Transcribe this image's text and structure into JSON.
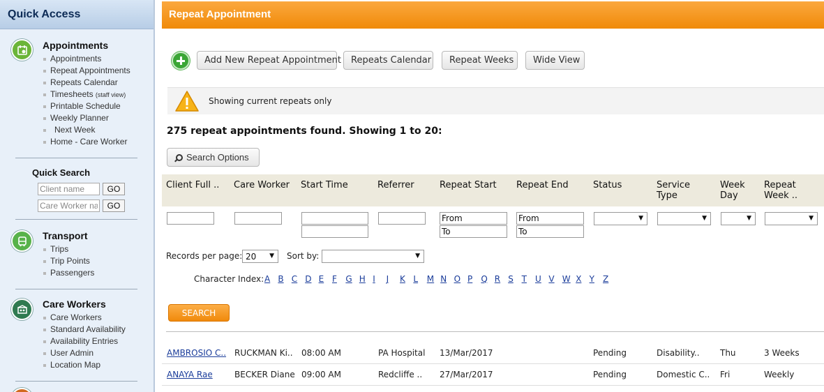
{
  "sidebar": {
    "title": "Quick Access",
    "appointments": {
      "title": "Appointments",
      "items": [
        "Appointments",
        "Repeat Appointments",
        "Repeats Calendar",
        "Timesheets",
        "Printable Schedule",
        "Weekly Planner",
        "Next Week",
        "Home - Care Worker"
      ],
      "timesheets_note": "(staff view)"
    },
    "quick_search": {
      "title": "Quick Search",
      "client_placeholder": "Client name",
      "care_worker_placeholder": "Care Worker name",
      "go_label": "GO"
    },
    "transport": {
      "title": "Transport",
      "items": [
        "Trips",
        "Trip Points",
        "Passengers"
      ]
    },
    "care_workers": {
      "title": "Care Workers",
      "items": [
        "Care Workers",
        "Standard Availability",
        "Availability Entries",
        "User Admin",
        "Location Map"
      ]
    }
  },
  "main": {
    "title": "Repeat Appointment",
    "toolbar": {
      "add_new": "Add New Repeat Appointment",
      "repeats_calendar": "Repeats Calendar",
      "repeat_weeks": "Repeat Weeks",
      "wide_view": "Wide View"
    },
    "notice": "Showing current repeats only",
    "results_count": "275 repeat appointments found. Showing 1 to 20:",
    "search_options": "Search Options",
    "columns": [
      "Client Full ..",
      "Care Worker",
      "Start Time",
      "Referrer",
      "Repeat Start",
      "Repeat End",
      "Status",
      "Service Type",
      "Week Day",
      "Repeat Week .."
    ],
    "filters": {
      "from_placeholder": "From",
      "to_placeholder": "To"
    },
    "records_per_page_label": "Records per page:",
    "records_per_page_value": "20",
    "sort_by_label": "Sort by:",
    "sort_by_value": "",
    "character_index_label": "Character Index:",
    "letters": [
      "A",
      "B",
      "C",
      "D",
      "E",
      "F",
      "G",
      "H",
      "I",
      "J",
      "K",
      "L",
      "M",
      "N",
      "O",
      "P",
      "Q",
      "R",
      "S",
      "T",
      "U",
      "V",
      "W",
      "X",
      "Y",
      "Z"
    ],
    "search_button": "SEARCH",
    "rows": [
      {
        "client": "AMBROSIO C..",
        "care_worker": "RUCKMAN Ki..",
        "start_time": "08:00 AM",
        "referrer": "PA Hospital",
        "repeat_start": "13/Mar/2017",
        "repeat_end": "",
        "status": "Pending",
        "service_type": "Disability..",
        "week_day": "Thu",
        "repeat_week": "3 Weeks"
      },
      {
        "client": "ANAYA Rae",
        "care_worker": "BECKER Diane",
        "start_time": "09:00 AM",
        "referrer": "Redcliffe ..",
        "repeat_start": "27/Mar/2017",
        "repeat_end": "",
        "status": "Pending",
        "service_type": "Domestic C..",
        "week_day": "Fri",
        "repeat_week": "Weekly"
      }
    ]
  },
  "colors": {
    "orange": "#f08a08",
    "sidebar_bg": "#e8f0f9",
    "link": "#1a3c9a"
  }
}
